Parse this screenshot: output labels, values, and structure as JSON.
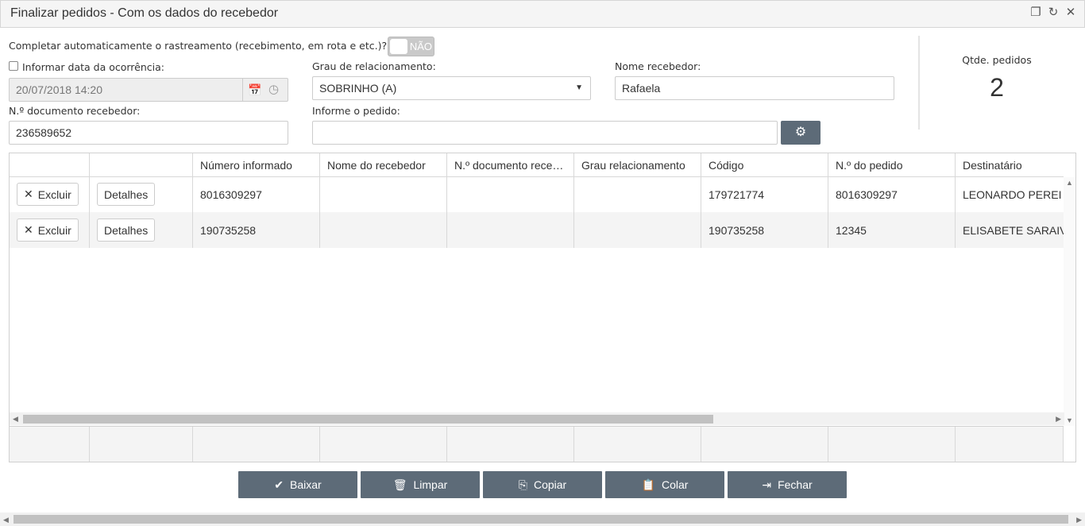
{
  "window": {
    "title": "Finalizar pedidos - Com os dados do recebedor",
    "icons": [
      "restore-icon",
      "refresh-icon",
      "close-icon"
    ]
  },
  "form": {
    "auto_complete_label": "Completar automaticamente o rastreamento (recebimento, em rota e etc.)?",
    "auto_complete_toggle": "NÃO",
    "inform_date_label": "Informar data da ocorrência:",
    "date_value": "20/07/2018 14:20",
    "relationship_label": "Grau de relacionamento:",
    "relationship_value": "SOBRINHO (A)",
    "receiver_name_label": "Nome recebedor:",
    "receiver_name_value": "Rafaela",
    "doc_label": "N.º documento recebedor:",
    "doc_value": "236589652",
    "order_label": "Informe o pedido:",
    "order_value": ""
  },
  "summary": {
    "qty_label": "Qtde. pedidos",
    "qty_value": "2"
  },
  "grid": {
    "columns": [
      "",
      "",
      "Número informado",
      "Nome do recebedor",
      "N.º documento rece…",
      "Grau relacionamento",
      "Código",
      "N.º do pedido",
      "Destinatário"
    ],
    "delete_label": "Excluir",
    "details_label": "Detalhes",
    "rows": [
      {
        "numero": "8016309297",
        "nome": "",
        "documento": "",
        "grau": "",
        "codigo": "179721774",
        "pedido": "8016309297",
        "destinatario": "LEONARDO PEREI"
      },
      {
        "numero": "190735258",
        "nome": "",
        "documento": "",
        "grau": "",
        "codigo": "190735258",
        "pedido": "12345",
        "destinatario": "ELISABETE SARAIV"
      }
    ]
  },
  "actions": {
    "baixar": "Baixar",
    "limpar": "Limpar",
    "copiar": "Copiar",
    "colar": "Colar",
    "fechar": "Fechar"
  },
  "colors": {
    "button_bg": "#5d6b78",
    "titlebar_bg": "#f5f5f5"
  }
}
